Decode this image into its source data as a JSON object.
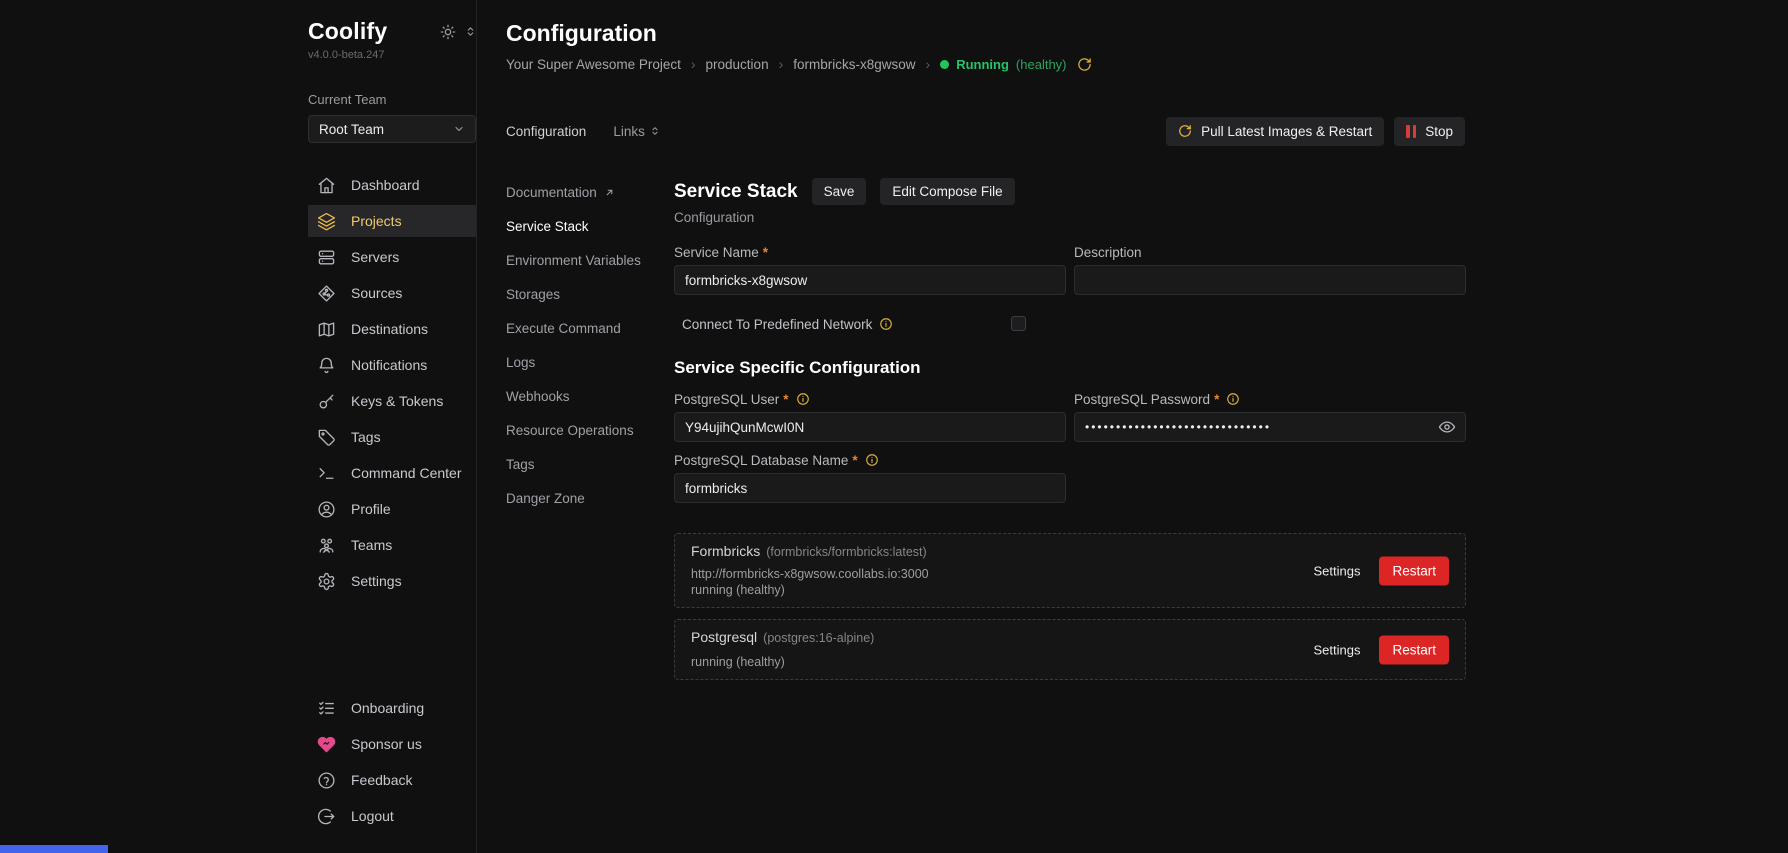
{
  "app": {
    "name": "Coolify",
    "version": "v4.0.0-beta.247"
  },
  "team": {
    "label": "Current Team",
    "selected": "Root Team"
  },
  "sidebar": {
    "items": [
      {
        "label": "Dashboard",
        "icon": "home-icon",
        "active": false
      },
      {
        "label": "Projects",
        "icon": "layers-icon",
        "active": true
      },
      {
        "label": "Servers",
        "icon": "server-icon",
        "active": false
      },
      {
        "label": "Sources",
        "icon": "git-source-icon",
        "active": false
      },
      {
        "label": "Destinations",
        "icon": "map-icon",
        "active": false
      },
      {
        "label": "Notifications",
        "icon": "bell-icon",
        "active": false
      },
      {
        "label": "Keys & Tokens",
        "icon": "key-icon",
        "active": false
      },
      {
        "label": "Tags",
        "icon": "tag-icon",
        "active": false
      },
      {
        "label": "Command Center",
        "icon": "terminal-icon",
        "active": false
      },
      {
        "label": "Profile",
        "icon": "user-circle-icon",
        "active": false
      },
      {
        "label": "Teams",
        "icon": "users-icon",
        "active": false
      },
      {
        "label": "Settings",
        "icon": "gear-icon",
        "active": false
      }
    ],
    "footer_items": [
      {
        "label": "Onboarding",
        "icon": "checklist-icon"
      },
      {
        "label": "Sponsor us",
        "icon": "heart-icon"
      },
      {
        "label": "Feedback",
        "icon": "question-circle-icon"
      },
      {
        "label": "Logout",
        "icon": "logout-icon"
      }
    ]
  },
  "header": {
    "title": "Configuration",
    "breadcrumb": [
      "Your Super Awesome Project",
      "production",
      "formbricks-x8gwsow"
    ],
    "status": {
      "label": "Running",
      "detail": "(healthy)"
    }
  },
  "tabs": [
    {
      "label": "Configuration",
      "active": true
    },
    {
      "label": "Links",
      "active": false
    }
  ],
  "toolbar": {
    "pull_restart_label": "Pull Latest Images & Restart",
    "stop_label": "Stop"
  },
  "subnav": {
    "items": [
      {
        "label": "Documentation",
        "external": true
      },
      {
        "label": "Service Stack",
        "active": true
      },
      {
        "label": "Environment Variables"
      },
      {
        "label": "Storages"
      },
      {
        "label": "Execute Command"
      },
      {
        "label": "Logs"
      },
      {
        "label": "Webhooks"
      },
      {
        "label": "Resource Operations"
      },
      {
        "label": "Tags"
      },
      {
        "label": "Danger Zone"
      }
    ]
  },
  "form": {
    "heading": "Service Stack",
    "save_label": "Save",
    "edit_compose_label": "Edit Compose File",
    "subtitle": "Configuration",
    "service_name": {
      "label": "Service Name",
      "value": "formbricks-x8gwsow"
    },
    "description": {
      "label": "Description",
      "value": ""
    },
    "connect_network": {
      "label": "Connect To Predefined Network",
      "checked": false
    },
    "section_heading": "Service Specific Configuration",
    "pg_user": {
      "label": "PostgreSQL User",
      "value": "Y94ujihQunMcwI0N"
    },
    "pg_password": {
      "label": "PostgreSQL Password",
      "masked_value": "••••••••••••••••••••••••••••••"
    },
    "pg_db": {
      "label": "PostgreSQL Database Name",
      "value": "formbricks"
    }
  },
  "services": [
    {
      "name": "Formbricks",
      "image": "(formbricks/formbricks:latest)",
      "url": "http://formbricks-x8gwsow.coollabs.io:3000",
      "status": "running (healthy)",
      "settings_label": "Settings",
      "restart_label": "Restart"
    },
    {
      "name": "Postgresql",
      "image": "(postgres:16-alpine)",
      "url": "",
      "status": "running (healthy)",
      "settings_label": "Settings",
      "restart_label": "Restart"
    }
  ],
  "colors": {
    "background": "#101010",
    "accent_yellow": "#f3c96b",
    "running_green": "#23c55e",
    "danger_red": "#dc2626",
    "sponsor_pink": "#e5488b",
    "info_yellow": "#d9b13b",
    "edge_fragment_blue": "#4263eb"
  }
}
